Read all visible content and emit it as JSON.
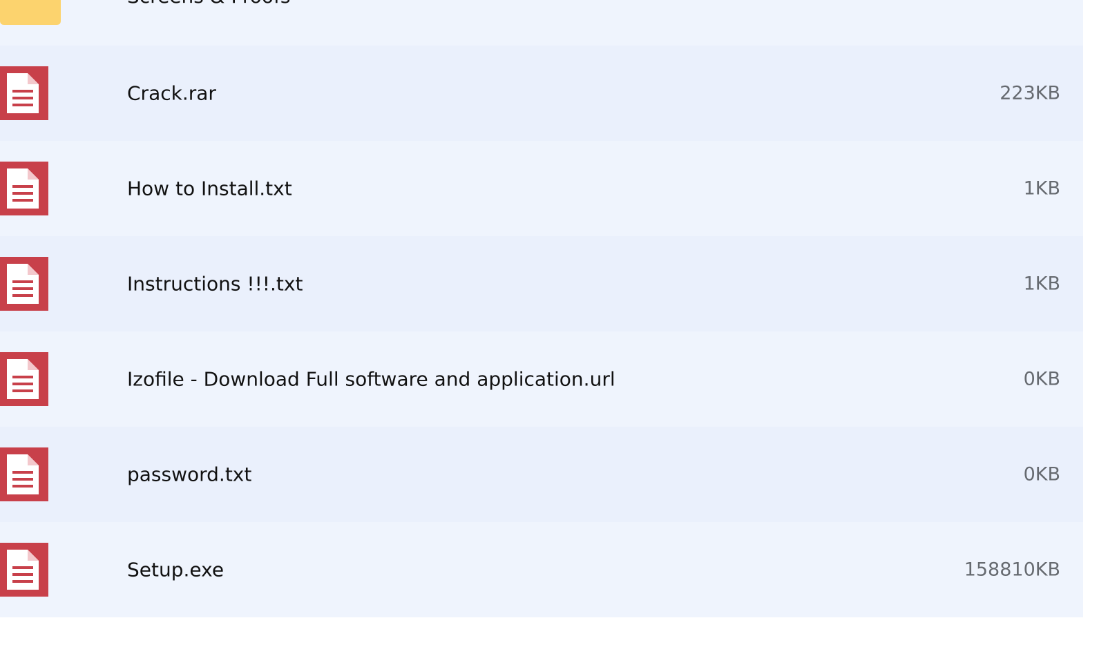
{
  "files": {
    "folder_partial": {
      "name": "Screens & Proofs"
    },
    "items": [
      {
        "name": "Crack.rar",
        "size": "223KB"
      },
      {
        "name": "How to Install.txt",
        "size": "1KB"
      },
      {
        "name": "Instructions !!!.txt",
        "size": "1KB"
      },
      {
        "name": "Izofile - Download Full software and application.url",
        "size": "0KB"
      },
      {
        "name": "password.txt",
        "size": "0KB"
      },
      {
        "name": "Setup.exe",
        "size": "158810KB"
      }
    ]
  },
  "icons": {
    "folder": "folder-icon",
    "file": "document-icon"
  },
  "colors": {
    "file_icon_red": "#c8404a",
    "folder_yellow": "#fcd36e",
    "row_alt": "#eaf0fc",
    "row_base": "#eff4fd"
  }
}
